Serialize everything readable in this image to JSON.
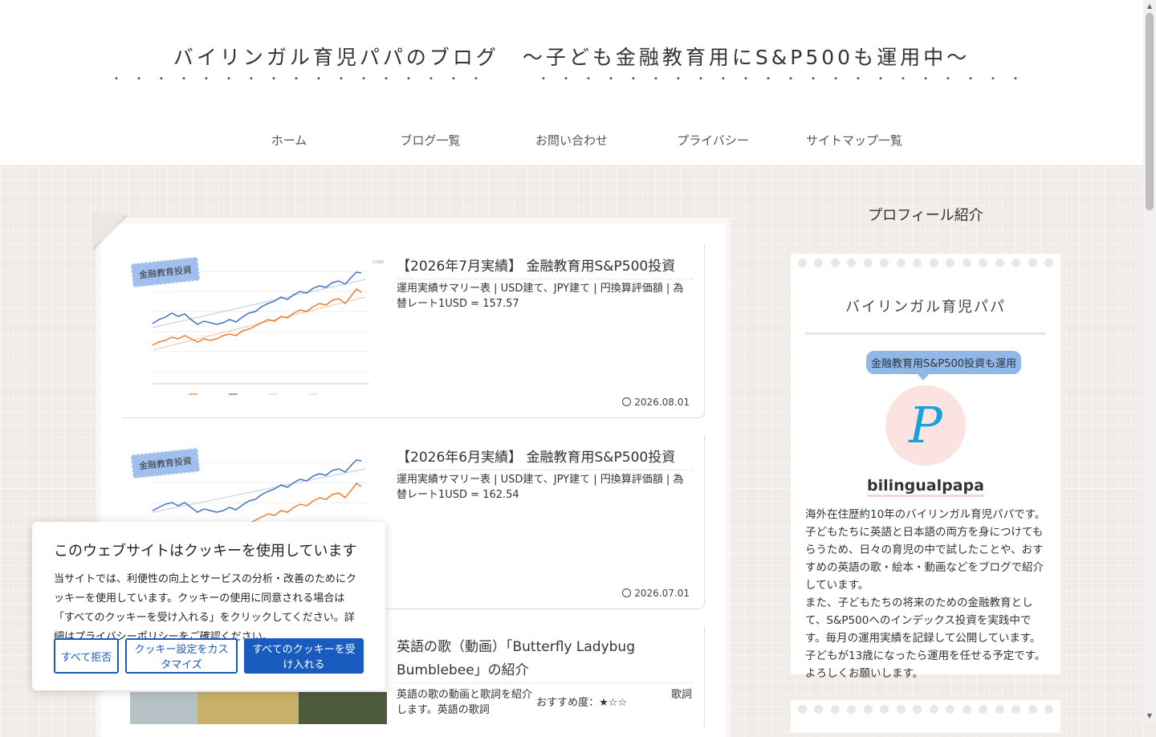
{
  "header": {
    "site_title": "バイリンガル育児パパのブログ　～子ども金融教育用にS&P500も運用中～",
    "title_dots": "・・・・・・・・・・・・・・・・・　　・・・・・・・・・・・・・・・・・・・・・・",
    "nav": [
      "ホーム",
      "ブログ一覧",
      "お問い合わせ",
      "プライバシー",
      "サイトマップ一覧"
    ]
  },
  "posts": [
    {
      "category": "金融教育投資",
      "title": "【2026年7月実績】 金融教育用S&P500投資",
      "snippet": "運用実績サマリー表 | USD建て、JPY建て | 円換算評価額 | 為替レート1USD = 157.57",
      "date": "2026.08.01"
    },
    {
      "category": "金融教育投資",
      "title": "【2026年6月実績】 金融教育用S&P500投資",
      "snippet": "運用実績サマリー表 | USD建て、JPY建て | 円換算評価額 | 為替レート1USD = 162.54",
      "date": "2026.07.01"
    },
    {
      "title": "英語の歌（動画）「Butterfly Ladybug Bumblebee」の紹介",
      "snippet_left": "英語の歌の動画と歌詞を紹介します。英語の歌詞",
      "snippet_right": "おすすめ度：★☆☆",
      "snippet_tail": "歌詞"
    }
  ],
  "sidebar": {
    "heading": "プロフィール紹介",
    "name": "バイリンガル育児パパ",
    "bubble": "金融教育用S&P500投資も運用",
    "avatar_letter": "P",
    "username": "bilingualpapa",
    "bio": [
      "海外在住歴約10年のバイリンガル育児パパです。子どもたちに英語と日本語の両方を身につけてもらうため、日々の育児の中で試したことや、おすすめの英語の歌・絵本・動画などをブログで紹介しています。",
      "また、子どもたちの将来のための金融教育として、S&P500へのインデックス投資を実践中です。毎月の運用実績を記録して公開しています。子どもが13歳になったら運用を任せる予定です。よろしくお願いします。"
    ]
  },
  "cookie": {
    "title": "このウェブサイトはクッキーを使用しています",
    "text": "当サイトでは、利便性の向上とサービスの分析・改善のためにクッキーを使用しています。クッキーの使用に同意される場合は「すべてのクッキーを受け入れる」をクリックしてください。詳細はプライバシーポリシーをご確認ください。",
    "btn_reject": "すべて拒否",
    "btn_settings": "クッキー設定をカスタマイズ",
    "btn_accept": "すべてのクッキーを受け入れる"
  },
  "colors": {
    "accent_blue": "#1a5bbf",
    "label_blue": "#8fb8e8",
    "chart_orange": "#ed7d31",
    "chart_blue": "#4472c4"
  }
}
